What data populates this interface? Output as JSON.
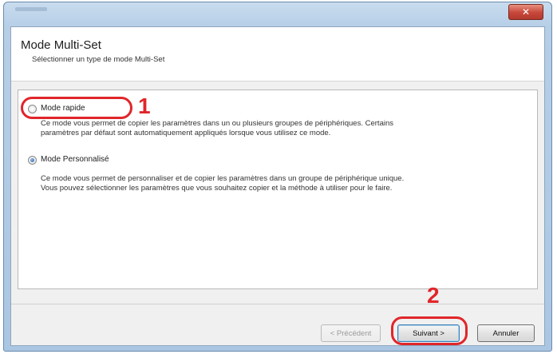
{
  "window": {
    "close_symbol": "✕"
  },
  "header": {
    "title": "Mode Multi-Set",
    "subtitle": "Sélectionner un type de mode Multi-Set"
  },
  "options": [
    {
      "label": "Mode rapide",
      "selected": false,
      "description": [
        "Ce mode vous permet de copier les paramètres dans un ou plusieurs groupes de périphériques. Certains",
        "paramètres par défaut sont automatiquement appliqués lorsque vous utilisez ce mode."
      ]
    },
    {
      "label": "Mode Personnalisé",
      "selected": true,
      "description": [
        "Ce mode vous permet de personnaliser et de copier les paramètres dans un groupe de périphérique unique.",
        "Vous pouvez sélectionner les paramètres que vous souhaitez copier et la méthode à utiliser pour le faire."
      ]
    }
  ],
  "annotations": {
    "callout_1": "1",
    "callout_2": "2",
    "color": "#e0262a"
  },
  "footer": {
    "prev_label": "< Précédent",
    "next_label": "Suivant >",
    "cancel_label": "Annuler"
  }
}
